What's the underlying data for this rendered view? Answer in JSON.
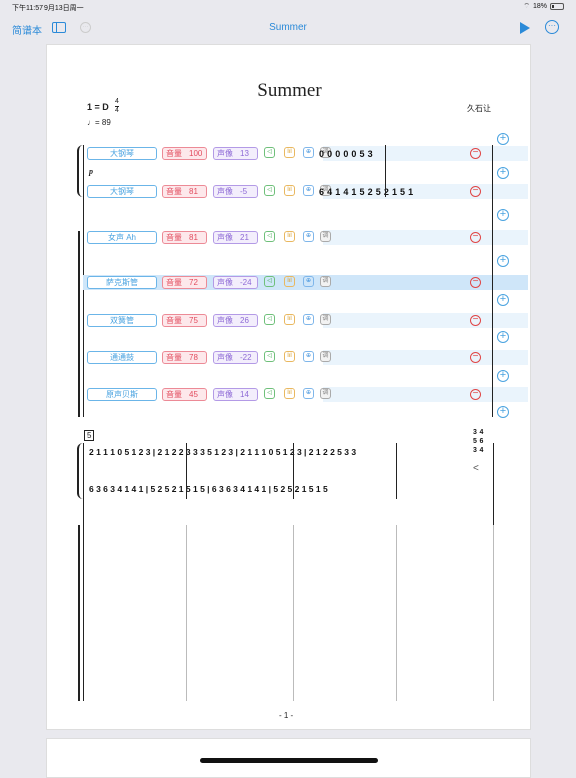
{
  "status": {
    "time": "下午11:57",
    "date": "9月13日周一",
    "battery": "18%"
  },
  "nav": {
    "back_label": "简谱本",
    "title": "Summer"
  },
  "score": {
    "title": "Summer",
    "key": "1 = D",
    "time_sig_top": "4",
    "time_sig_bottom": "4",
    "tempo": "♩= 89",
    "composer": "久石让",
    "dynamic": "p",
    "measure_number": "5",
    "page_number": "- 1 -"
  },
  "tracks": [
    {
      "instrument": "大钢琴",
      "vol_label": "音量",
      "vol": "100",
      "pan_label": "声像",
      "pan": "13"
    },
    {
      "instrument": "大钢琴",
      "vol_label": "音量",
      "vol": "81",
      "pan_label": "声像",
      "pan": "-5"
    },
    {
      "instrument": "女声 Ah",
      "vol_label": "音量",
      "vol": "81",
      "pan_label": "声像",
      "pan": "21"
    },
    {
      "instrument": "萨克斯管",
      "vol_label": "音量",
      "vol": "72",
      "pan_label": "声像",
      "pan": "-24"
    },
    {
      "instrument": "双簧管",
      "vol_label": "音量",
      "vol": "75",
      "pan_label": "声像",
      "pan": "26"
    },
    {
      "instrument": "通通鼓",
      "vol_label": "音量",
      "vol": "78",
      "pan_label": "声像",
      "pan": "-22"
    },
    {
      "instrument": "原声贝斯",
      "vol_label": "音量",
      "vol": "45",
      "pan_label": "声像",
      "pan": "14"
    }
  ],
  "icons": {
    "speaker": "speaker-icon",
    "chord": "chord-icon",
    "sync": "sync-icon",
    "tune": "调"
  },
  "system1_notes": {
    "track1": "0   0     0   0   0   5 3",
    "track2": "6   4 1   4 1   5 2   5 2   1 5   1"
  },
  "system2_notes": {
    "upper": "2 1 1 1   0   5 1 2 3 | 2 1 2 2 3  3 3   5 1 2 3 | 2 1 1 1   0   5 1 2 3 | 2 1 2 2 5  3 3",
    "lower": "6 3  6 3  4 1  4 1 | 5 2  5 2  1 5  1 5 | 6 3  6 3  4 1  4 1 | 5 2  5 2  1 5  1 5",
    "chord_top": "3 4",
    "chord_mid": "5 6",
    "chord_bot": "3 4"
  }
}
